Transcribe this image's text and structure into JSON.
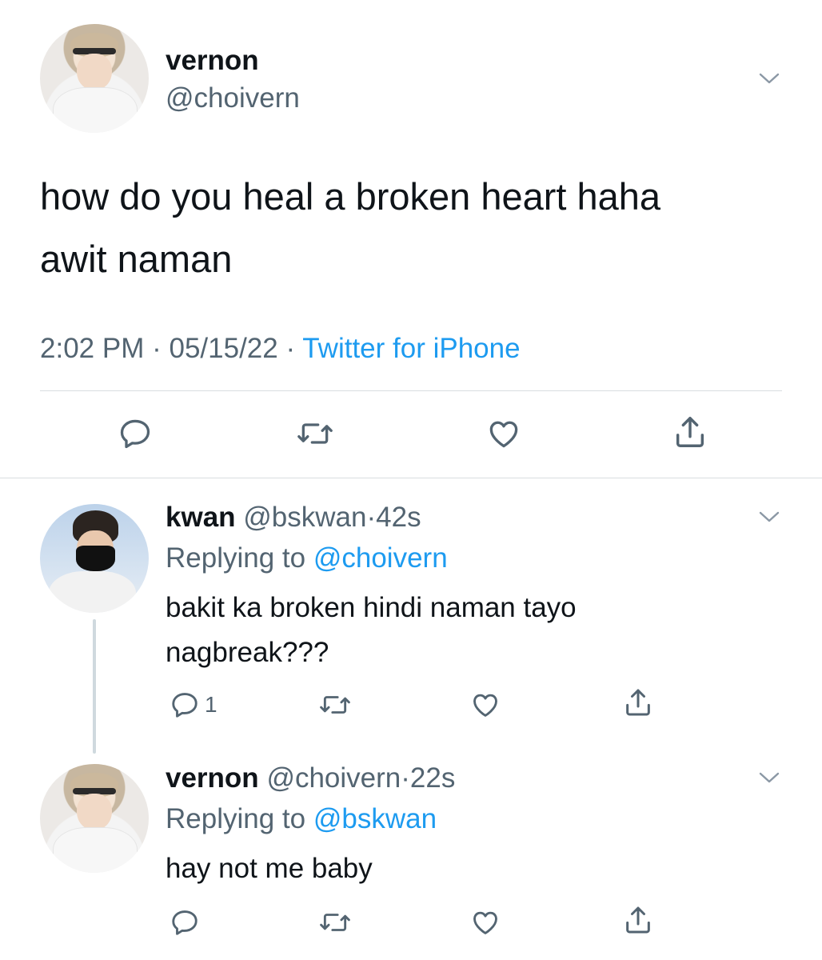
{
  "main_tweet": {
    "display_name": "vernon",
    "handle": "@choivern",
    "text_line1": "how do you heal a broken heart haha",
    "text_line2": "awit naman",
    "time": "2:02 PM",
    "date": "05/15/22",
    "separator": "·",
    "source": "Twitter for iPhone"
  },
  "replies": [
    {
      "display_name": "kwan",
      "handle": "@bskwan",
      "age": "42s",
      "replying_label": "Replying to",
      "replying_to": "@choivern",
      "text_line1": "bakit ka broken hindi naman tayo",
      "text_line2": "nagbreak???",
      "reply_count": "1"
    },
    {
      "display_name": "vernon",
      "handle": "@choivern",
      "age": "22s",
      "replying_label": "Replying to",
      "replying_to": "@bskwan",
      "text_line1": "hay not me baby"
    }
  ],
  "icons": [
    "chevron-down-icon",
    "reply-icon",
    "retweet-icon",
    "like-icon",
    "share-icon"
  ],
  "colors": {
    "link": "#1d9bf0",
    "muted": "#536471",
    "text": "#0f1419"
  }
}
